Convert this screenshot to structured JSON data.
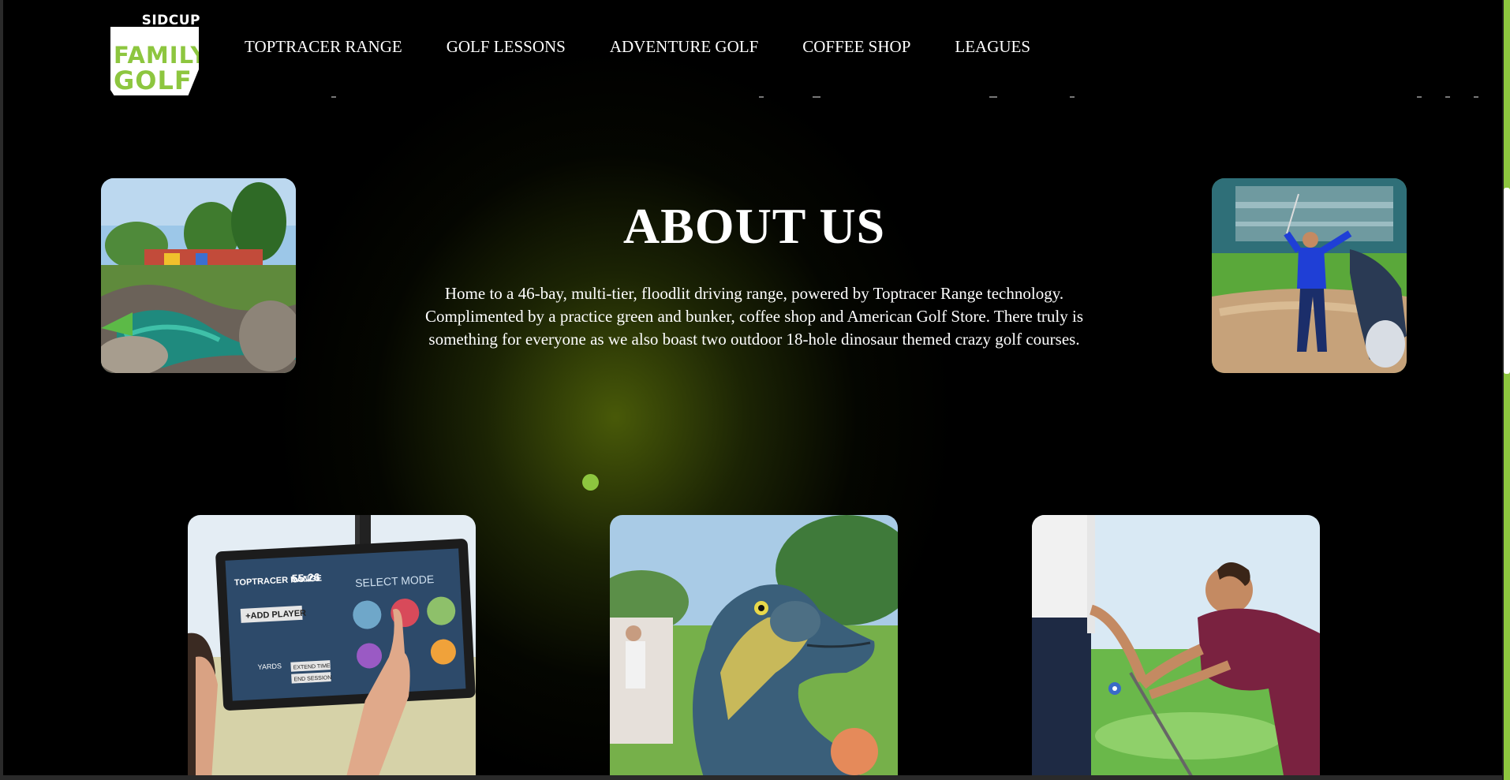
{
  "header": {
    "logo": {
      "top_text": "SIDCUP",
      "line1": "FAMILY",
      "line2": "GOLF"
    },
    "nav": [
      {
        "label": "TOPTRACER RANGE"
      },
      {
        "label": "GOLF LESSONS"
      },
      {
        "label": "ADVENTURE GOLF"
      },
      {
        "label": "COFFEE SHOP"
      },
      {
        "label": "LEAGUES"
      }
    ]
  },
  "about": {
    "title": "ABOUT US",
    "body": "Home to a 46-bay, multi-tier, floodlit driving range, powered by Toptracer Range technology. Complimented by a practice green and bunker, coffee shop and American Golf Store. There truly is something for everyone as we also boast two outdoor 18-hole dinosaur themed crazy golf courses."
  },
  "colors": {
    "accent": "#8dc63f",
    "background": "#000000",
    "text": "#ffffff"
  },
  "images": {
    "left": "adventure-golf-course-photo",
    "right": "golfer-bunker-shot-photo",
    "card1": "toptracer-screen-photo",
    "card2": "dinosaur-statue-photo",
    "card3": "golf-lesson-photo"
  },
  "toptracer_screen": {
    "brand": "TOPTRACER RANGE",
    "time": "55:26",
    "mode_title": "SELECT MODE",
    "add_player": "+ADD PLAYER",
    "yards": "YARDS",
    "extend": "EXTEND TIME",
    "end": "END SESSION"
  }
}
